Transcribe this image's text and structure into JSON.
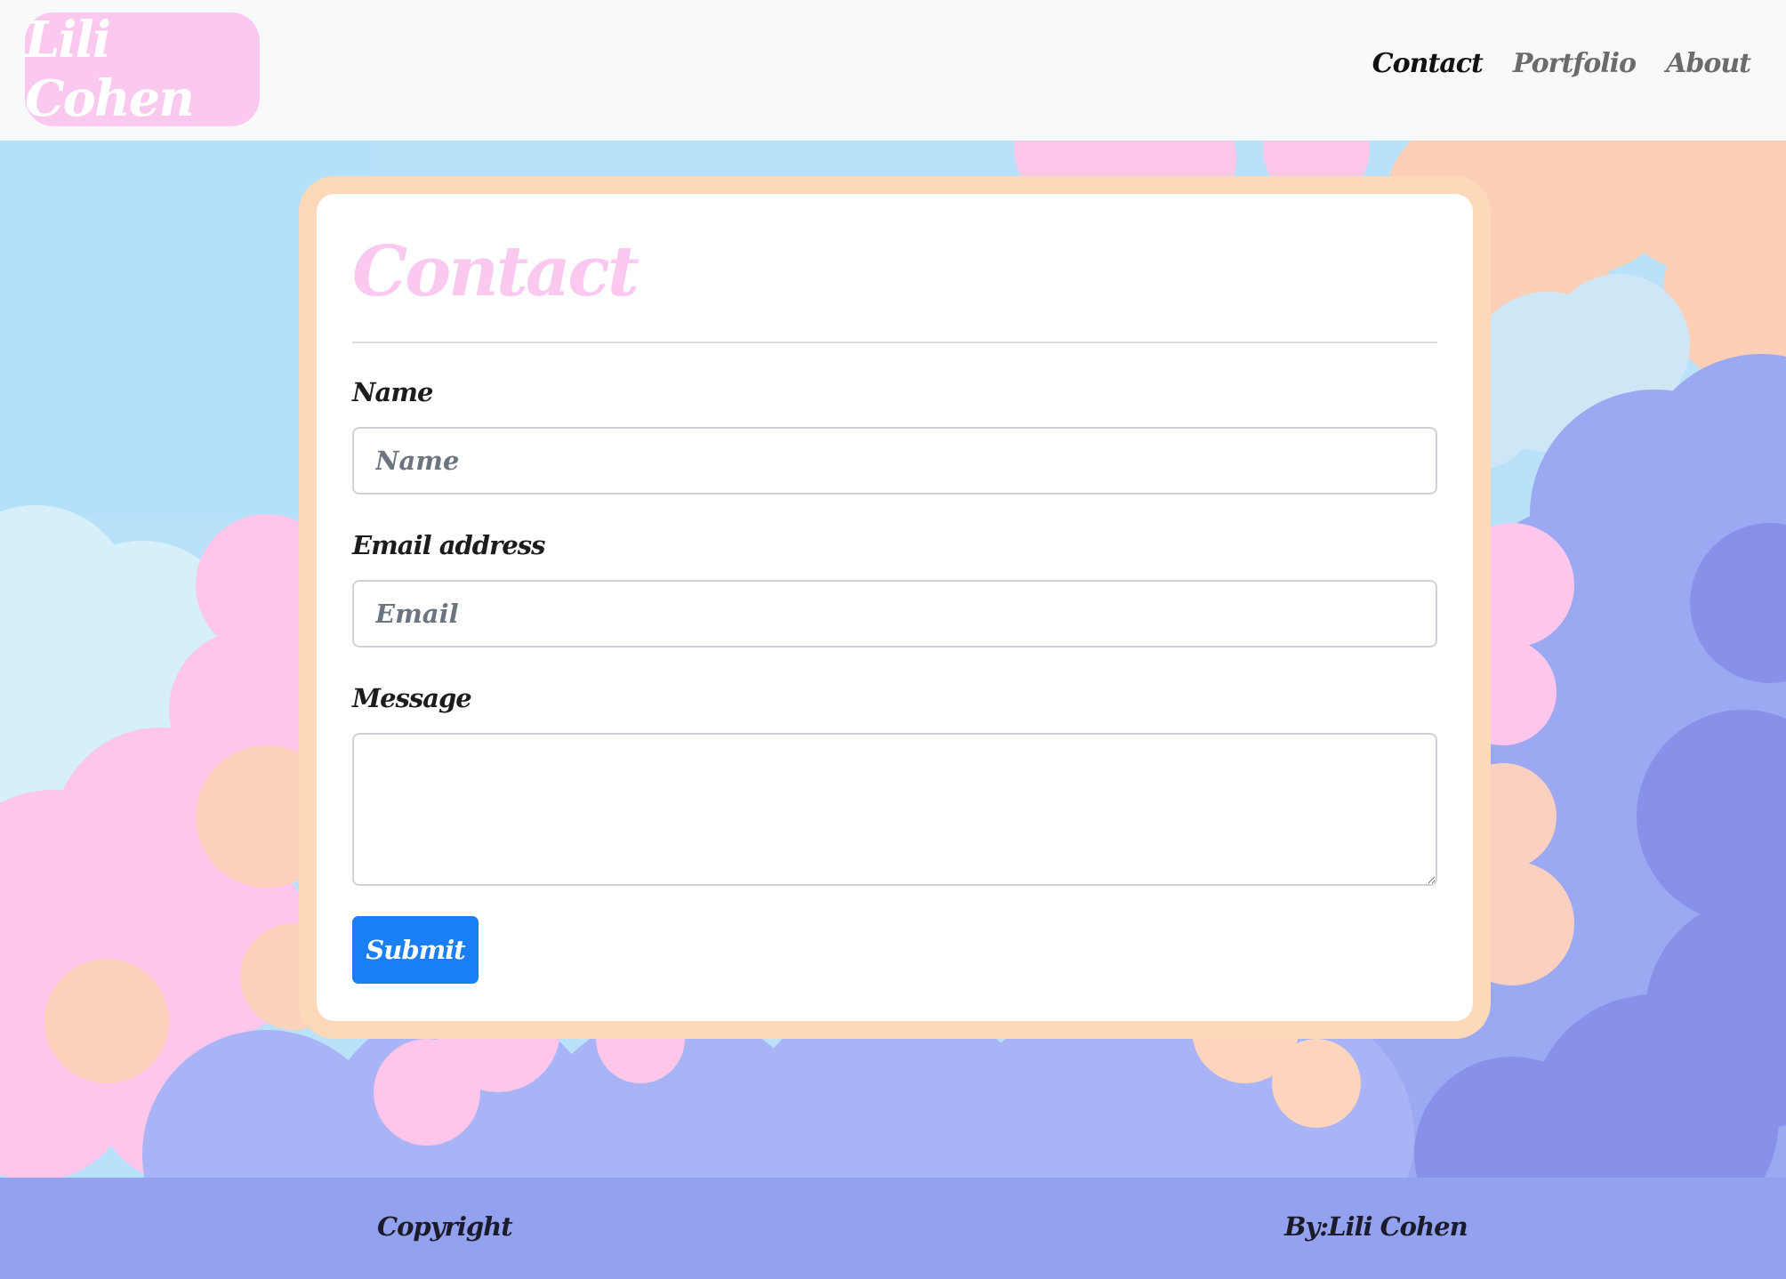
{
  "navbar": {
    "brand": "Lili Cohen",
    "links": [
      {
        "label": "Contact",
        "active": true
      },
      {
        "label": "Portfolio",
        "active": false
      },
      {
        "label": "About",
        "active": false
      }
    ]
  },
  "form": {
    "title": "Contact",
    "name_label": "Name",
    "name_placeholder": "Name",
    "email_label": "Email address",
    "email_placeholder": "Email",
    "message_label": "Message",
    "message_value": "",
    "submit_label": "Submit"
  },
  "footer": {
    "copyright": "Copyright",
    "author": "By:Lili Cohen"
  },
  "colors": {
    "brand_pink": "#fbc8ef",
    "card_border_peach": "#fdd9b9",
    "submit_blue": "#1a7ff5",
    "footer_periwinkle": "#93a2ee",
    "navbar_bg": "#f8f9fa"
  }
}
